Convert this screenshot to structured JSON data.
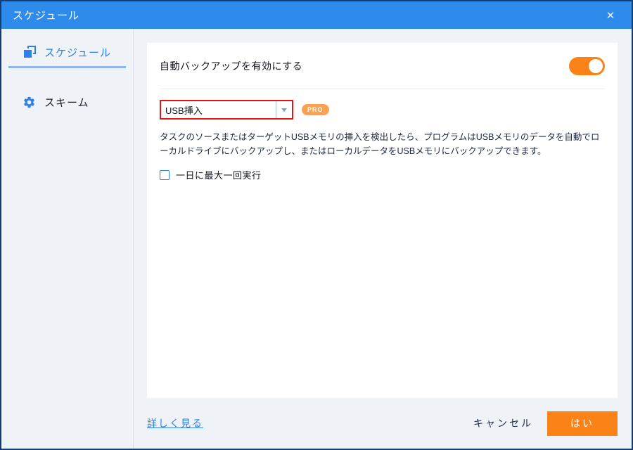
{
  "window": {
    "title": "スケジュール",
    "close_glyph": "✕"
  },
  "sidebar": {
    "items": [
      {
        "label": "スケジュール",
        "icon": "schedule-icon",
        "active": true
      },
      {
        "label": "スキーム",
        "icon": "gear-icon",
        "active": false
      }
    ]
  },
  "main": {
    "enable_label": "自動バックアップを有効にする",
    "toggle_state": "on",
    "dropdown": {
      "value": "USB挿入",
      "highlighted": true
    },
    "pro_badge": "PRO",
    "description": "タスクのソースまたはターゲットUSBメモリの挿入を検出したら、プログラムはUSBメモリのデータを自動でローカルドライブにバックアップし、またはローカルデータをUSBメモリにバックアップできます。",
    "checkbox": {
      "label": "一日に最大一回実行",
      "checked": false
    }
  },
  "footer": {
    "learn_more": "詳しく見る",
    "cancel_label": "キャンセル",
    "ok_label": "はい"
  },
  "colors": {
    "titlebar": "#2E8BEB",
    "accent_blue": "#2E7FE8",
    "accent_orange": "#FB8217",
    "badge_orange": "#F9A254",
    "highlight_red": "#E21414",
    "window_border": "#123E72",
    "panel_bg": "#EFF2F7"
  }
}
